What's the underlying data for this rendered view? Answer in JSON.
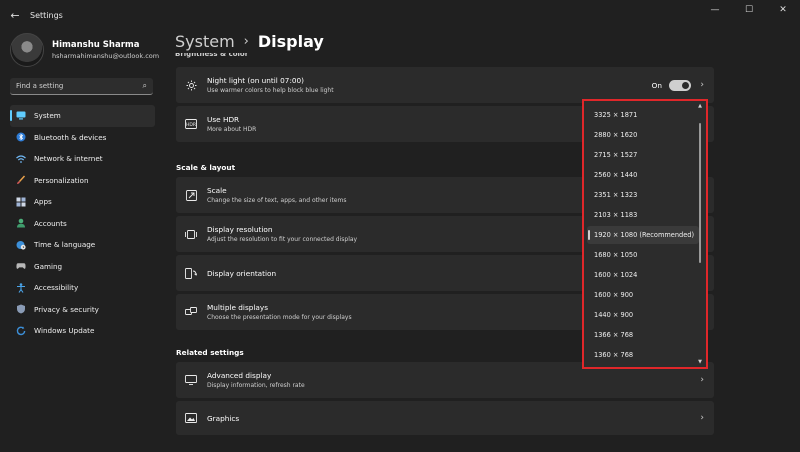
{
  "window": {
    "title": "Settings",
    "controls": {
      "minimize": "—",
      "maximize": "☐",
      "close": "✕"
    }
  },
  "profile": {
    "name": "Himanshu Sharma",
    "email": "hsharmahimanshu@outlook.com"
  },
  "search": {
    "placeholder": "Find a setting"
  },
  "nav": {
    "items": [
      {
        "label": "System",
        "icon": "monitor-icon",
        "active": true
      },
      {
        "label": "Bluetooth & devices",
        "icon": "bluetooth-icon"
      },
      {
        "label": "Network & internet",
        "icon": "wifi-icon"
      },
      {
        "label": "Personalization",
        "icon": "brush-icon"
      },
      {
        "label": "Apps",
        "icon": "apps-icon"
      },
      {
        "label": "Accounts",
        "icon": "person-icon"
      },
      {
        "label": "Time & language",
        "icon": "globe-clock-icon"
      },
      {
        "label": "Gaming",
        "icon": "gamepad-icon"
      },
      {
        "label": "Accessibility",
        "icon": "accessibility-icon"
      },
      {
        "label": "Privacy & security",
        "icon": "shield-icon"
      },
      {
        "label": "Windows Update",
        "icon": "update-icon"
      }
    ]
  },
  "header": {
    "crumb1": "System",
    "separator": "›",
    "crumb2": "Display"
  },
  "section_cut": "Brightness & color",
  "cards": {
    "night_light": {
      "title": "Night light (on until 07:00)",
      "sub": "Use warmer colors to help block blue light",
      "state": "On"
    },
    "hdr": {
      "title": "Use HDR",
      "sub": "More about HDR"
    },
    "scale": {
      "title": "Scale",
      "sub": "Change the size of text, apps, and other items"
    },
    "resolution": {
      "title": "Display resolution",
      "sub": "Adjust the resolution to fit your connected display"
    },
    "orientation": {
      "title": "Display orientation"
    },
    "multiple": {
      "title": "Multiple displays",
      "sub": "Choose the presentation mode for your displays"
    },
    "advanced": {
      "title": "Advanced display",
      "sub": "Display information, refresh rate"
    },
    "graphics": {
      "title": "Graphics"
    }
  },
  "sections": {
    "scale_layout": "Scale & layout",
    "related": "Related settings"
  },
  "resolution_options": [
    "3325 × 1871",
    "2880 × 1620",
    "2715 × 1527",
    "2560 × 1440",
    "2351 × 1323",
    "2103 × 1183",
    "1920 × 1080 (Recommended)",
    "1680 × 1050",
    "1600 × 1024",
    "1600 × 900",
    "1440 × 900",
    "1366 × 768",
    "1360 × 768"
  ],
  "selected_resolution_index": 6,
  "colors": {
    "accent": "#60cdff",
    "highlight_border": "#e0272a",
    "background": "#202020",
    "card": "#2b2b2b"
  }
}
